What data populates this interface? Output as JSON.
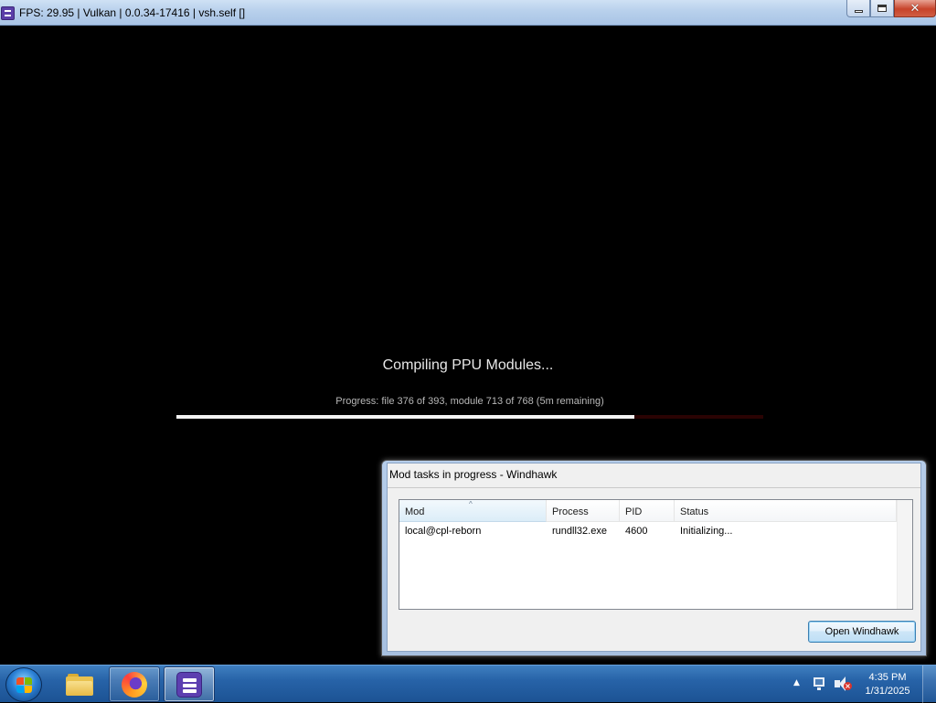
{
  "window": {
    "title": "FPS: 29.95 | Vulkan | 0.0.34-17416 | vsh.self []",
    "icon": "rpcs3-icon"
  },
  "game": {
    "heading": "Compiling PPU Modules...",
    "progress_text": "Progress: file 376 of 393, module 713 of 768 (5m remaining)",
    "progress_fraction": 0.78
  },
  "windhawk": {
    "title": "Mod tasks in progress - Windhawk",
    "columns": [
      "Mod",
      "Process",
      "PID",
      "Status"
    ],
    "rows": [
      {
        "mod": "local@cpl-reborn",
        "process": "rundll32.exe",
        "pid": "4600",
        "status": "Initializing..."
      }
    ],
    "open_button": "Open Windhawk"
  },
  "taskbar": {
    "items": [
      "start-orb",
      "explorer-icon",
      "firefox-icon",
      "rpcs3-icon"
    ],
    "clock_time": "4:35 PM",
    "clock_date": "1/31/2025",
    "tray": [
      "show-hidden-icons",
      "network-icon",
      "volume-muted-icon"
    ]
  }
}
